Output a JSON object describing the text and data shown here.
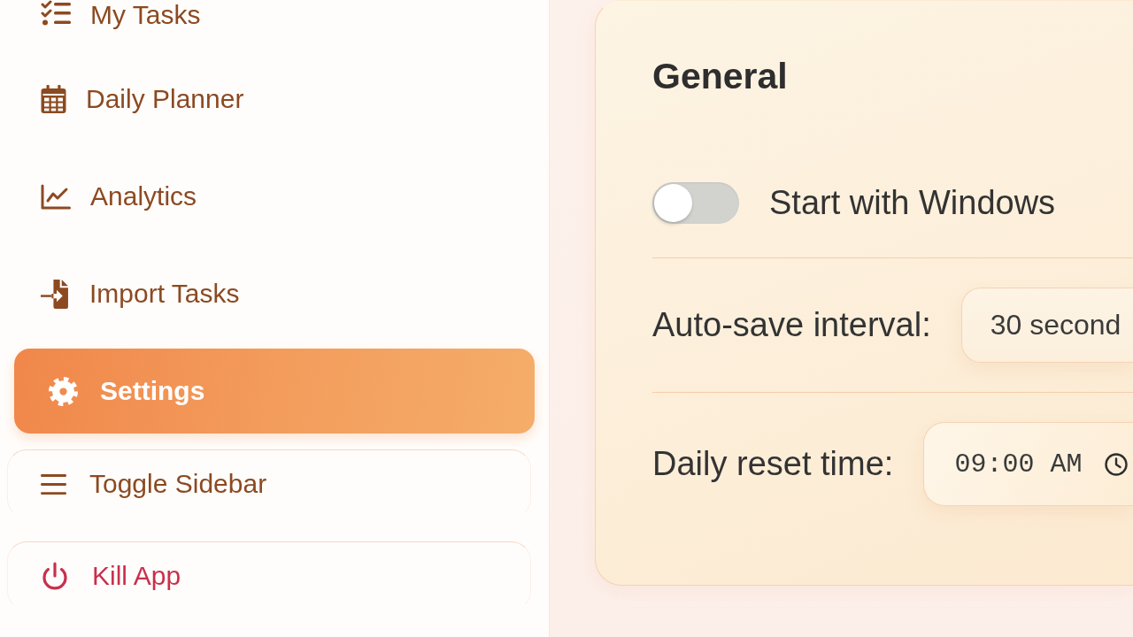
{
  "sidebar": {
    "items": [
      {
        "label": "My Tasks",
        "selected": false
      },
      {
        "label": "Daily Planner",
        "selected": false
      },
      {
        "label": "Analytics",
        "selected": false
      },
      {
        "label": "Import Tasks",
        "selected": false
      },
      {
        "label": "Settings",
        "selected": true
      }
    ],
    "actions": [
      {
        "label": "Toggle Sidebar",
        "kind": "toggle"
      },
      {
        "label": "Kill App",
        "kind": "danger"
      }
    ]
  },
  "settings_card": {
    "title": "General",
    "rows": [
      {
        "kind": "switch",
        "label": "Start with Windows",
        "on": false
      },
      {
        "kind": "select",
        "label": "Auto-save interval:",
        "value": "30 second"
      },
      {
        "kind": "time",
        "label": "Daily reset time:",
        "value": "09:00 AM"
      }
    ]
  }
}
